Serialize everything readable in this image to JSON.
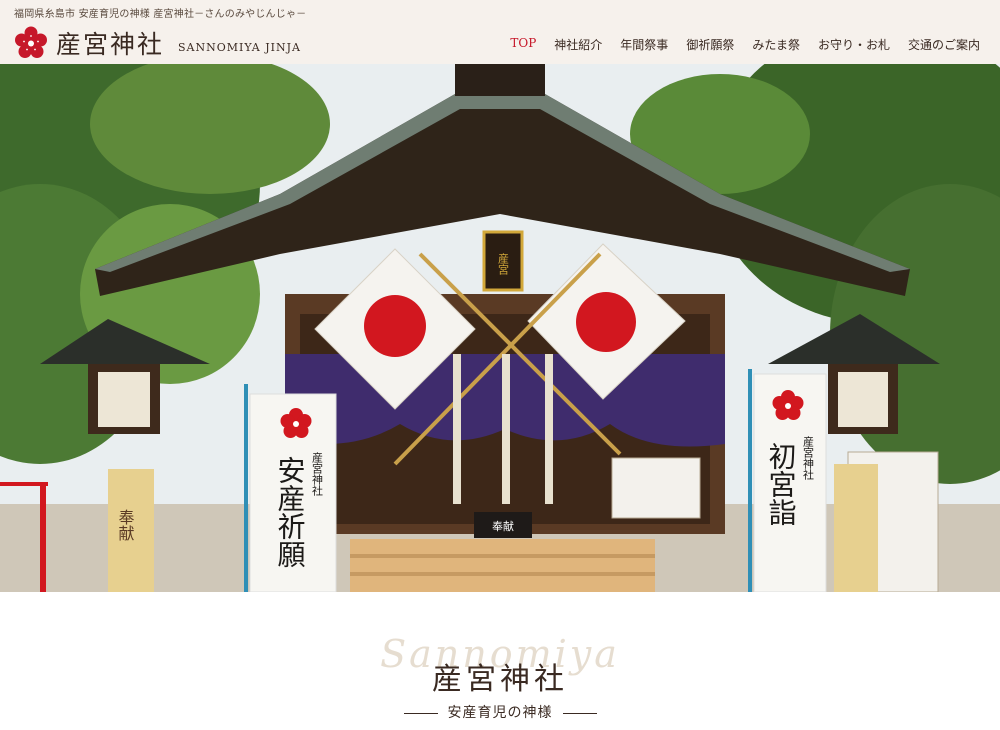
{
  "header": {
    "tagline": "福岡県糸島市 安産育児の神様 産宮神社－さんのみやじんじゃ－",
    "site_title": "産宮神社",
    "site_title_roman": "SANNOMIYA JINJA",
    "logo_icon": "plum-blossom-icon",
    "brand_color": "#c6182a"
  },
  "nav": {
    "items": [
      {
        "label": "TOP",
        "active": true
      },
      {
        "label": "神社紹介",
        "active": false
      },
      {
        "label": "年間祭事",
        "active": false
      },
      {
        "label": "御祈願祭",
        "active": false
      },
      {
        "label": "みたま祭",
        "active": false
      },
      {
        "label": "お守り・お札",
        "active": false
      },
      {
        "label": "交通のご案内",
        "active": false
      }
    ]
  },
  "hero": {
    "shrine_plaque": "産宮",
    "offertory_box": "奉献",
    "banner_left": "安産祈願",
    "banner_left_small": "産宮神社",
    "banner_right": "初宮詣",
    "banner_right_small": "産宮神社",
    "lantern_base_left": "奉献"
  },
  "intro": {
    "script_text": "Sannomiya",
    "title": "産宮神社",
    "subtitle": "安産育児の神様"
  }
}
